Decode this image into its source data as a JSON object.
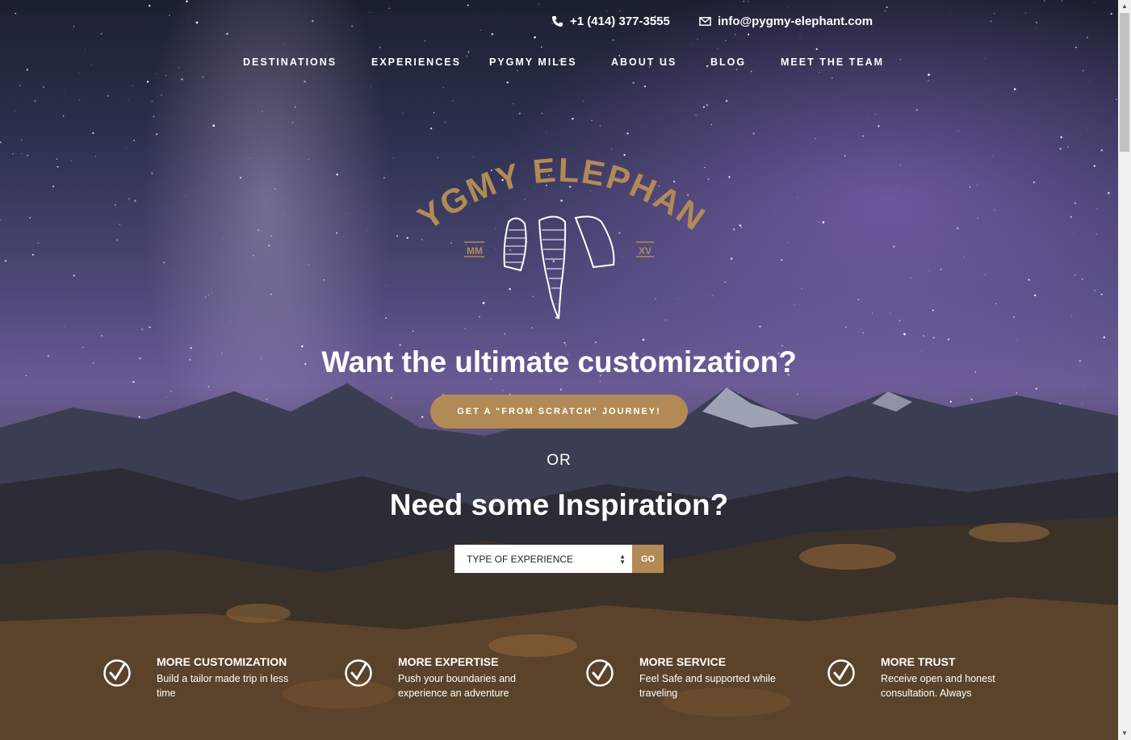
{
  "contact": {
    "phone": "+1 (414) 377-3555",
    "email": "info@pygmy-elephant.com"
  },
  "nav": [
    {
      "label": "DESTINATIONS"
    },
    {
      "label": "EXPERIENCES"
    },
    {
      "label": "PYGMY MILES"
    },
    {
      "label": "ABOUT US"
    },
    {
      "label": "BLOG"
    },
    {
      "label": "MEET THE TEAM"
    }
  ],
  "logo": {
    "text": "PYGMY ELEPHANT",
    "left_mark": "MM",
    "right_mark": "XV",
    "color": "#b18a56"
  },
  "hero": {
    "question1": "Want the ultimate customization?",
    "cta_label": "GET A \"FROM SCRATCH\" JOURNEY!",
    "or_text": "OR",
    "question2": "Need some Inspiration?",
    "select_value": "TYPE OF EXPERIENCE",
    "go_label": "GO"
  },
  "features": [
    {
      "title": "MORE CUSTOMIZATION",
      "desc": "Build a tailor made trip in less time",
      "icon": "check-circle-icon"
    },
    {
      "title": "MORE EXPERTISE",
      "desc": "Push your boundaries and experience an adventure",
      "icon": "check-circle-icon"
    },
    {
      "title": "MORE SERVICE",
      "desc": "Feel Safe and supported while traveling",
      "icon": "check-circle-icon"
    },
    {
      "title": "MORE TRUST",
      "desc": "Receive open and honest consultation. Always",
      "icon": "check-circle-icon"
    }
  ],
  "colors": {
    "accent": "#b18a56",
    "text": "#ffffff"
  }
}
